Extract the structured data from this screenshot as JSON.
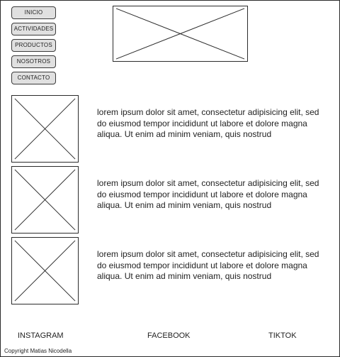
{
  "nav": {
    "items": [
      {
        "label": "INICIO"
      },
      {
        "label": "ACTIVIDADES"
      },
      {
        "label": "PRODUCTOS"
      },
      {
        "label": "NOSOTROS"
      },
      {
        "label": "CONTACTO"
      }
    ]
  },
  "content": {
    "rows": [
      {
        "text": "lorem ipsum dolor sit amet, consectetur adipisicing elit, sed do eiusmod tempor incididunt ut labore et dolore magna aliqua. Ut enim ad minim veniam, quis nostrud"
      },
      {
        "text": "lorem ipsum dolor sit amet, consectetur adipisicing elit, sed do eiusmod tempor incididunt ut labore et dolore magna aliqua. Ut enim ad minim veniam, quis nostrud"
      },
      {
        "text": "lorem ipsum dolor sit amet, consectetur adipisicing elit, sed do eiusmod tempor incididunt ut labore et dolore magna aliqua. Ut enim ad minim veniam, quis nostrud"
      }
    ]
  },
  "footer": {
    "social": {
      "instagram": "INSTAGRAM",
      "facebook": "FACEBOOK",
      "tiktok": "TIKTOK"
    },
    "copyright": "Copyright Matias Nicodella"
  }
}
